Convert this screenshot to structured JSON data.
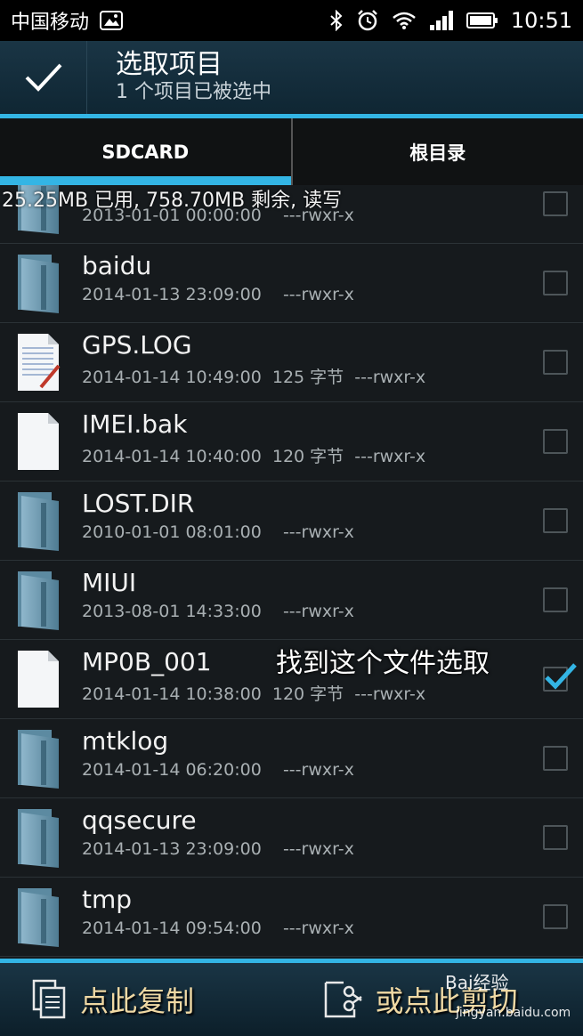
{
  "status_bar": {
    "carrier": "中国移动",
    "time": "10:51"
  },
  "action_bar": {
    "title": "选取项目",
    "subtitle": "1 个项目已被选中"
  },
  "tabs": [
    {
      "label": "SDCARD",
      "active": true
    },
    {
      "label": "根目录",
      "active": false
    }
  ],
  "storage_info": "25.25MB 已用, 758.70MB 剩余, 读写",
  "files": [
    {
      "name": "",
      "meta": "2013-01-01 00:00:00    ---rwxr-x",
      "icon": "folder-icon",
      "checked": false
    },
    {
      "name": "baidu",
      "meta": "2014-01-13 23:09:00    ---rwxr-x",
      "icon": "folder-icon",
      "checked": false
    },
    {
      "name": "GPS.LOG",
      "meta": "2014-01-14 10:49:00  125 字节  ---rwxr-x",
      "icon": "text-file-icon",
      "checked": false
    },
    {
      "name": "IMEI.bak",
      "meta": "2014-01-14 10:40:00  120 字节  ---rwxr-x",
      "icon": "file-icon",
      "checked": false
    },
    {
      "name": "LOST.DIR",
      "meta": "2010-01-01 08:01:00    ---rwxr-x",
      "icon": "folder-icon",
      "checked": false
    },
    {
      "name": "MIUI",
      "meta": "2013-08-01 14:33:00    ---rwxr-x",
      "icon": "folder-icon",
      "checked": false
    },
    {
      "name": "MP0B_001",
      "meta": "2014-01-14 10:38:00  120 字节  ---rwxr-x",
      "icon": "file-icon",
      "checked": true
    },
    {
      "name": "mtklog",
      "meta": "2014-01-14 06:20:00    ---rwxr-x",
      "icon": "folder-icon",
      "checked": false
    },
    {
      "name": "qqsecure",
      "meta": "2014-01-13 23:09:00    ---rwxr-x",
      "icon": "folder-icon",
      "checked": false
    },
    {
      "name": "tmp",
      "meta": "2014-01-14 09:54:00    ---rwxr-x",
      "icon": "folder-icon",
      "checked": false
    }
  ],
  "annotation": "找到这个文件选取",
  "bottom_bar": {
    "copy_label": "点此复制",
    "cut_label": "或点此剪切"
  },
  "watermark": {
    "text": "Bai经验",
    "url": "jingyan.baidu.com"
  },
  "colors": {
    "accent": "#33b5e5",
    "button_text": "#f0d9a4"
  }
}
